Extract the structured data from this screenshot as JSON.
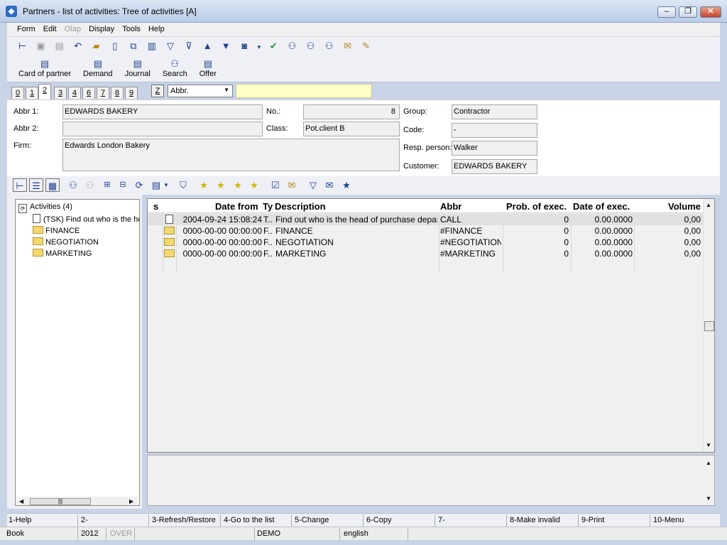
{
  "window": {
    "title": "Partners - list of activities: Tree of activities [A]"
  },
  "menu": {
    "items": [
      {
        "label": "Form",
        "enabled": true
      },
      {
        "label": "Edit",
        "enabled": true
      },
      {
        "label": "Olap",
        "enabled": false
      },
      {
        "label": "Display",
        "enabled": true
      },
      {
        "label": "Tools",
        "enabled": true
      },
      {
        "label": "Help",
        "enabled": true
      }
    ]
  },
  "big_toolbar": [
    {
      "label": "Card of partner"
    },
    {
      "label": "Demand"
    },
    {
      "label": "Journal"
    },
    {
      "label": "Search"
    },
    {
      "label": "Offer"
    }
  ],
  "tabs": {
    "items": [
      "0",
      "1",
      "2",
      "3",
      "4",
      "6",
      "7",
      "8",
      "9"
    ],
    "active": "2",
    "z_label": "Z",
    "abbr_select": "Abbr.",
    "search_value": ""
  },
  "form": {
    "abbr1_label": "Abbr 1:",
    "abbr1": "EDWARDS BAKERY",
    "abbr2_label": "Abbr 2:",
    "abbr2": "",
    "firm_label": "Firm:",
    "firm": "Edwards London Bakery",
    "no_label": "No.:",
    "no": "8",
    "class_label": "Class:",
    "class": "Pot.client B",
    "group_label": "Group:",
    "group": "Contractor",
    "code_label": "Code:",
    "code": "-",
    "resp_label": "Resp. person:",
    "resp": "Walker",
    "customer_label": "Customer:",
    "customer": "EDWARDS BAKERY"
  },
  "tree": {
    "root": "Activities (4)",
    "nodes": [
      {
        "label": "(TSK) Find out who is the he",
        "type": "doc"
      },
      {
        "label": "FINANCE",
        "type": "folder"
      },
      {
        "label": "NEGOTIATION",
        "type": "folder"
      },
      {
        "label": "MARKETING",
        "type": "folder"
      }
    ]
  },
  "grid": {
    "headers": {
      "s": "s",
      "date": "Date from",
      "ty": "Ty",
      "desc": "Description",
      "abbr": "Abbr",
      "prob": "Prob. of exec.",
      "datex": "Date of exec.",
      "volume": "Volume"
    },
    "rows": [
      {
        "type": "doc",
        "date": "2004-09-24 15:08:24",
        "ty": "T..",
        "desc": "Find out who is the head of purchase departm...",
        "abbr": "CALL",
        "prob": "0",
        "datex": "0.00.0000",
        "volume": "0,00"
      },
      {
        "type": "folder",
        "date": "0000-00-00 00:00:00",
        "ty": "F..",
        "desc": "FINANCE",
        "abbr": "#FINANCE",
        "prob": "0",
        "datex": "0.00.0000",
        "volume": "0,00"
      },
      {
        "type": "folder",
        "date": "0000-00-00 00:00:00",
        "ty": "F..",
        "desc": "NEGOTIATION",
        "abbr": "#NEGOTIATION",
        "prob": "0",
        "datex": "0.00.0000",
        "volume": "0,00"
      },
      {
        "type": "folder",
        "date": "0000-00-00 00:00:00",
        "ty": "F..",
        "desc": "MARKETING",
        "abbr": "#MARKETING",
        "prob": "0",
        "datex": "0.00.0000",
        "volume": "0,00"
      }
    ]
  },
  "fkeys": [
    "1-Help",
    "2-",
    "3-Refresh/Restore",
    "4-Go to the list",
    "5-Change",
    "6-Copy",
    "7-",
    "8-Make invalid",
    "9-Print",
    "10-Menu"
  ],
  "info": {
    "module": "Book",
    "year": "2012",
    "over": "OVER",
    "db": "DEMO",
    "lang": "english"
  }
}
